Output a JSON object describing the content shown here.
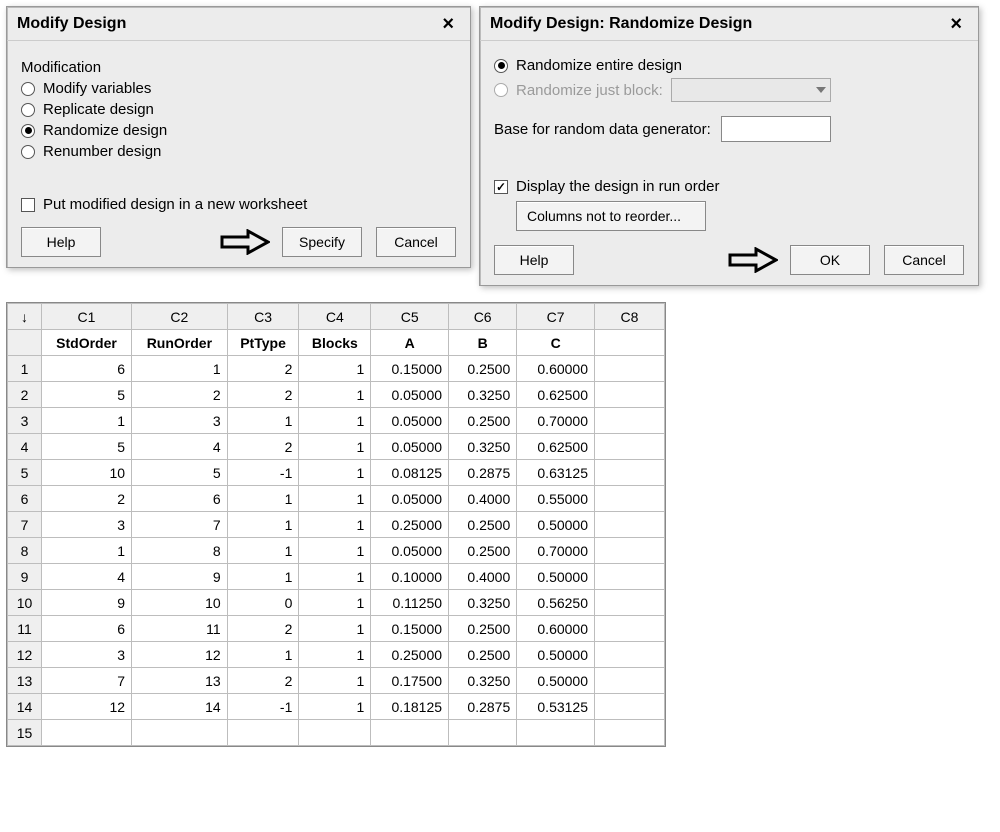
{
  "dialog1": {
    "title": "Modify Design",
    "section": "Modification",
    "options": {
      "modify_vars": "Modify variables",
      "replicate": "Replicate design",
      "randomize": "Randomize design",
      "renumber": "Renumber design"
    },
    "new_ws_label": "Put modified design in a new worksheet",
    "buttons": {
      "help": "Help",
      "specify": "Specify",
      "cancel": "Cancel"
    }
  },
  "dialog2": {
    "title": "Modify Design: Randomize Design",
    "rand_entire": "Randomize entire design",
    "rand_block": "Randomize just block:",
    "base_label": "Base for random data generator:",
    "display_run_order": "Display the design in run order",
    "cols_not_reorder": "Columns not to reorder...",
    "buttons": {
      "help": "Help",
      "ok": "OK",
      "cancel": "Cancel"
    }
  },
  "sheet": {
    "col_headers": [
      "C1",
      "C2",
      "C3",
      "C4",
      "C5",
      "C6",
      "C7",
      "C8"
    ],
    "col_names": [
      "StdOrder",
      "RunOrder",
      "PtType",
      "Blocks",
      "A",
      "B",
      "C",
      ""
    ],
    "rows": [
      {
        "n": 1,
        "v": [
          "6",
          "1",
          "2",
          "1",
          "0.15000",
          "0.2500",
          "0.60000",
          ""
        ]
      },
      {
        "n": 2,
        "v": [
          "5",
          "2",
          "2",
          "1",
          "0.05000",
          "0.3250",
          "0.62500",
          ""
        ]
      },
      {
        "n": 3,
        "v": [
          "1",
          "3",
          "1",
          "1",
          "0.05000",
          "0.2500",
          "0.70000",
          ""
        ]
      },
      {
        "n": 4,
        "v": [
          "5",
          "4",
          "2",
          "1",
          "0.05000",
          "0.3250",
          "0.62500",
          ""
        ]
      },
      {
        "n": 5,
        "v": [
          "10",
          "5",
          "-1",
          "1",
          "0.08125",
          "0.2875",
          "0.63125",
          ""
        ]
      },
      {
        "n": 6,
        "v": [
          "2",
          "6",
          "1",
          "1",
          "0.05000",
          "0.4000",
          "0.55000",
          ""
        ]
      },
      {
        "n": 7,
        "v": [
          "3",
          "7",
          "1",
          "1",
          "0.25000",
          "0.2500",
          "0.50000",
          ""
        ]
      },
      {
        "n": 8,
        "v": [
          "1",
          "8",
          "1",
          "1",
          "0.05000",
          "0.2500",
          "0.70000",
          ""
        ]
      },
      {
        "n": 9,
        "v": [
          "4",
          "9",
          "1",
          "1",
          "0.10000",
          "0.4000",
          "0.50000",
          ""
        ]
      },
      {
        "n": 10,
        "v": [
          "9",
          "10",
          "0",
          "1",
          "0.11250",
          "0.3250",
          "0.56250",
          ""
        ]
      },
      {
        "n": 11,
        "v": [
          "6",
          "11",
          "2",
          "1",
          "0.15000",
          "0.2500",
          "0.60000",
          ""
        ]
      },
      {
        "n": 12,
        "v": [
          "3",
          "12",
          "1",
          "1",
          "0.25000",
          "0.2500",
          "0.50000",
          ""
        ]
      },
      {
        "n": 13,
        "v": [
          "7",
          "13",
          "2",
          "1",
          "0.17500",
          "0.3250",
          "0.50000",
          ""
        ]
      },
      {
        "n": 14,
        "v": [
          "12",
          "14",
          "-1",
          "1",
          "0.18125",
          "0.2875",
          "0.53125",
          ""
        ]
      },
      {
        "n": 15,
        "v": [
          "",
          "",
          "",
          "",
          "",
          "",
          "",
          ""
        ]
      }
    ]
  }
}
